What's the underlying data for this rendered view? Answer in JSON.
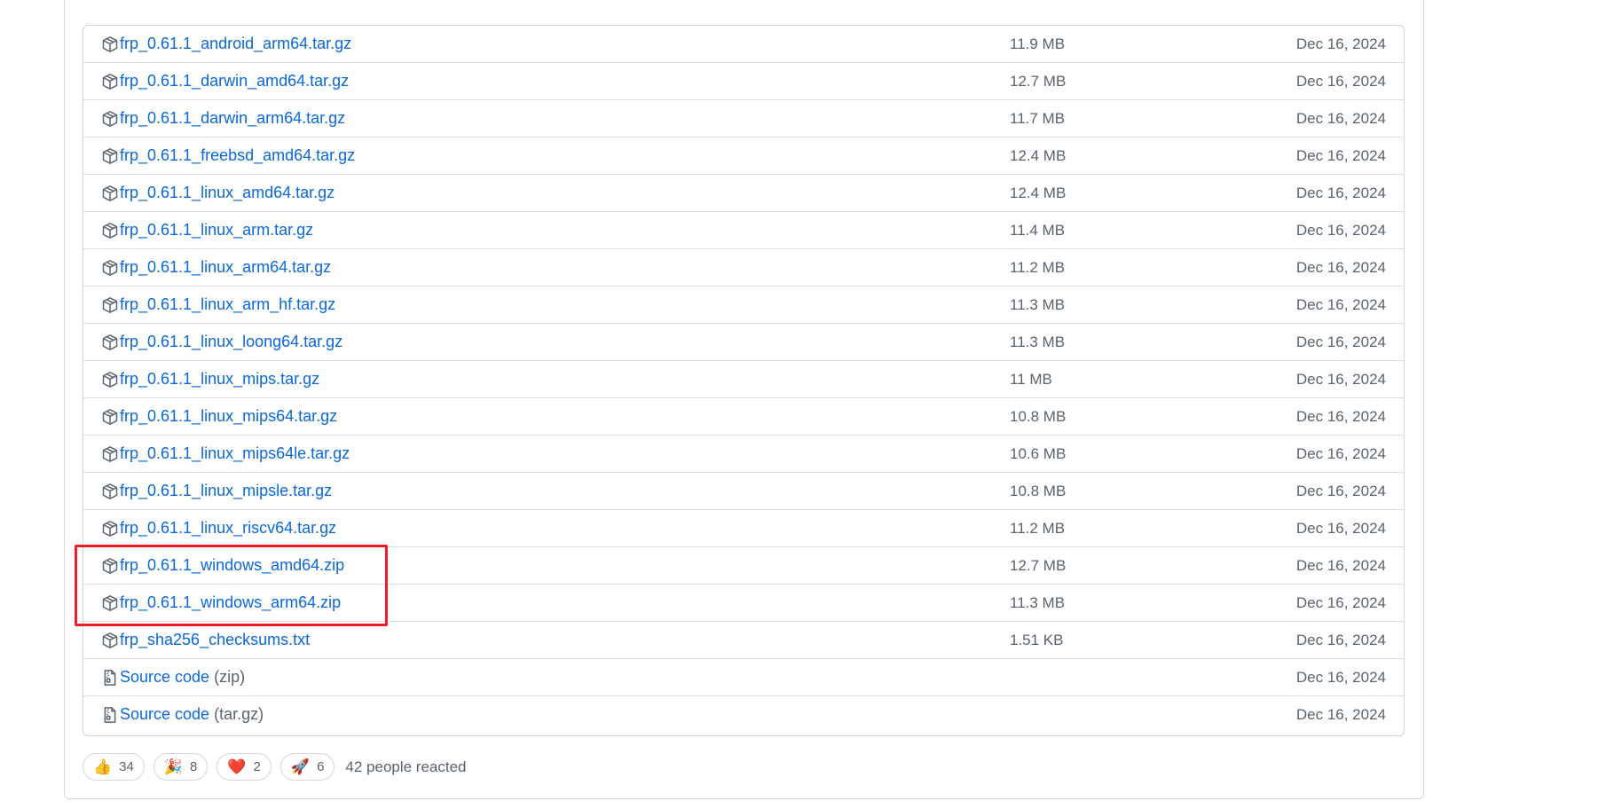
{
  "assets": [
    {
      "name": "frp_0.61.1_android_arm64.tar.gz",
      "suffix": "",
      "size": "11.9 MB",
      "date": "Dec 16, 2024",
      "icon": "package-icon"
    },
    {
      "name": "frp_0.61.1_darwin_amd64.tar.gz",
      "suffix": "",
      "size": "12.7 MB",
      "date": "Dec 16, 2024",
      "icon": "package-icon"
    },
    {
      "name": "frp_0.61.1_darwin_arm64.tar.gz",
      "suffix": "",
      "size": "11.7 MB",
      "date": "Dec 16, 2024",
      "icon": "package-icon"
    },
    {
      "name": "frp_0.61.1_freebsd_amd64.tar.gz",
      "suffix": "",
      "size": "12.4 MB",
      "date": "Dec 16, 2024",
      "icon": "package-icon"
    },
    {
      "name": "frp_0.61.1_linux_amd64.tar.gz",
      "suffix": "",
      "size": "12.4 MB",
      "date": "Dec 16, 2024",
      "icon": "package-icon"
    },
    {
      "name": "frp_0.61.1_linux_arm.tar.gz",
      "suffix": "",
      "size": "11.4 MB",
      "date": "Dec 16, 2024",
      "icon": "package-icon"
    },
    {
      "name": "frp_0.61.1_linux_arm64.tar.gz",
      "suffix": "",
      "size": "11.2 MB",
      "date": "Dec 16, 2024",
      "icon": "package-icon"
    },
    {
      "name": "frp_0.61.1_linux_arm_hf.tar.gz",
      "suffix": "",
      "size": "11.3 MB",
      "date": "Dec 16, 2024",
      "icon": "package-icon"
    },
    {
      "name": "frp_0.61.1_linux_loong64.tar.gz",
      "suffix": "",
      "size": "11.3 MB",
      "date": "Dec 16, 2024",
      "icon": "package-icon"
    },
    {
      "name": "frp_0.61.1_linux_mips.tar.gz",
      "suffix": "",
      "size": "11 MB",
      "date": "Dec 16, 2024",
      "icon": "package-icon"
    },
    {
      "name": "frp_0.61.1_linux_mips64.tar.gz",
      "suffix": "",
      "size": "10.8 MB",
      "date": "Dec 16, 2024",
      "icon": "package-icon"
    },
    {
      "name": "frp_0.61.1_linux_mips64le.tar.gz",
      "suffix": "",
      "size": "10.6 MB",
      "date": "Dec 16, 2024",
      "icon": "package-icon"
    },
    {
      "name": "frp_0.61.1_linux_mipsle.tar.gz",
      "suffix": "",
      "size": "10.8 MB",
      "date": "Dec 16, 2024",
      "icon": "package-icon"
    },
    {
      "name": "frp_0.61.1_linux_riscv64.tar.gz",
      "suffix": "",
      "size": "11.2 MB",
      "date": "Dec 16, 2024",
      "icon": "package-icon"
    },
    {
      "name": "frp_0.61.1_windows_amd64.zip",
      "suffix": "",
      "size": "12.7 MB",
      "date": "Dec 16, 2024",
      "icon": "package-icon"
    },
    {
      "name": "frp_0.61.1_windows_arm64.zip",
      "suffix": "",
      "size": "11.3 MB",
      "date": "Dec 16, 2024",
      "icon": "package-icon"
    },
    {
      "name": "frp_sha256_checksums.txt",
      "suffix": "",
      "size": "1.51 KB",
      "date": "Dec 16, 2024",
      "icon": "package-icon"
    },
    {
      "name": "Source code",
      "suffix": "(zip)",
      "size": "",
      "date": "Dec 16, 2024",
      "icon": "file-zip-icon"
    },
    {
      "name": "Source code",
      "suffix": "(tar.gz)",
      "size": "",
      "date": "Dec 16, 2024",
      "icon": "file-zip-icon"
    }
  ],
  "reactions": [
    {
      "emoji": "👍",
      "icon": "thumbs-up-icon",
      "count": "34"
    },
    {
      "emoji": "🎉",
      "icon": "hooray-icon",
      "count": "8"
    },
    {
      "emoji": "❤️",
      "icon": "heart-icon",
      "count": "2"
    },
    {
      "emoji": "🚀",
      "icon": "rocket-icon",
      "count": "6"
    }
  ],
  "reactions_summary": "42 people reacted",
  "colors": {
    "link": "#0969da",
    "muted": "#59636e",
    "border": "#d0d7de",
    "highlight": "#ee1c24"
  }
}
